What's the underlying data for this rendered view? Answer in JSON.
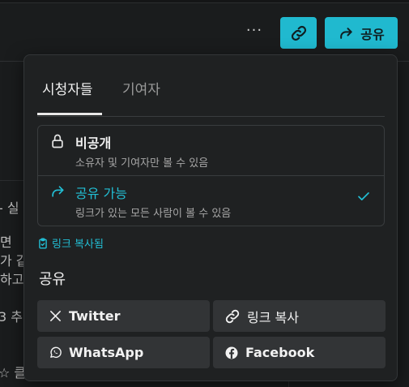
{
  "header": {
    "more_label": "···",
    "share_label": "공유"
  },
  "background": {
    "fragments": [
      "- 실",
      "면",
      "가 같",
      "하고",
      "3 추",
      "☆ 클"
    ]
  },
  "popover": {
    "tabs": [
      {
        "label": "시청자들",
        "active": true
      },
      {
        "label": "기여자",
        "active": false
      }
    ],
    "options": [
      {
        "title": "비공개",
        "desc": "소유자 및 기여자만 볼 수 있음",
        "icon": "lock-icon",
        "selected": false
      },
      {
        "title": "공유 가능",
        "desc": "링크가 있는 모든 사람이 볼 수 있음",
        "icon": "share-arrow-icon",
        "selected": true
      }
    ],
    "copied_label": "링크 복사됨",
    "share_section_title": "공유",
    "share_buttons": [
      {
        "label": "Twitter",
        "icon": "x-logo-icon"
      },
      {
        "label": "링크 복사",
        "icon": "link-icon"
      },
      {
        "label": "WhatsApp",
        "icon": "whatsapp-icon"
      },
      {
        "label": "Facebook",
        "icon": "facebook-icon"
      }
    ],
    "accent_color": "#22bfd5"
  }
}
